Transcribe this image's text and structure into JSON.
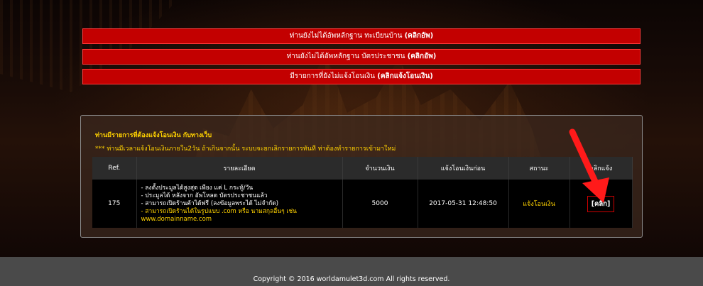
{
  "alerts": [
    {
      "text": "ท่านยังไม่ได้อัพหลักฐาน ทะเบียนบ้าน",
      "action": "(คลิกอัพ)"
    },
    {
      "text": "ท่านยังไม่ได้อัพหลักฐาน บัตรประชาชน",
      "action": "(คลิกอัพ)"
    },
    {
      "text": "มีรายการที่ยังไม่แจ้งโอนเงิน",
      "action": "(คลิกแจ้งโอนเงิน)"
    }
  ],
  "panel": {
    "title": "ท่านมีรายการที่ต้องแจ้งโอนเงิน กับทางเว็บ",
    "warning": "*** ท่านมีเวลาแจ้งโอนเงินภายใน2วัน ถ้าเกินจากนั้น ระบบจะยกเลิกรายการทันที ท่าต้องทำรายการเข้ามาใหม่"
  },
  "table": {
    "headers": [
      "Ref.",
      "รายละเอียด",
      "จำนวนเงิน",
      "แจ้งโอนเงินก่อน",
      "สถานะ",
      "คลิกแจ้ง"
    ],
    "rows": [
      {
        "ref": "175",
        "details": [
          "- ลงตั้งประมูลได้สูงสุด เพียง แค่ L กระทู้/วัน",
          "- ประมูลได้ หลังจาก อัพโหลด บัตรประชาชนแล้ว",
          "- สามารถเปิดร้านค้าได้ฟรี (ลงข้อมูลพระได้ ไม่จำกัด)"
        ],
        "details_highlight": [
          "- สามารถเปิดร้านได้ในรูปแบบ .com หรือ นามสกุลอื่นๆ เช่น",
          "www.domainname.com"
        ],
        "amount": "5000",
        "deadline": "2017-05-31 12:48:50",
        "status": "แจ้งโอนเงิน",
        "action": "[คลิก]"
      }
    ]
  },
  "footer": {
    "copyright": "Copyright © 2016 worldamulet3d.com All rights reserved."
  },
  "colors": {
    "alert_bg": "#c30000",
    "highlight": "#ffd200",
    "arrow": "#ff1a1a"
  }
}
